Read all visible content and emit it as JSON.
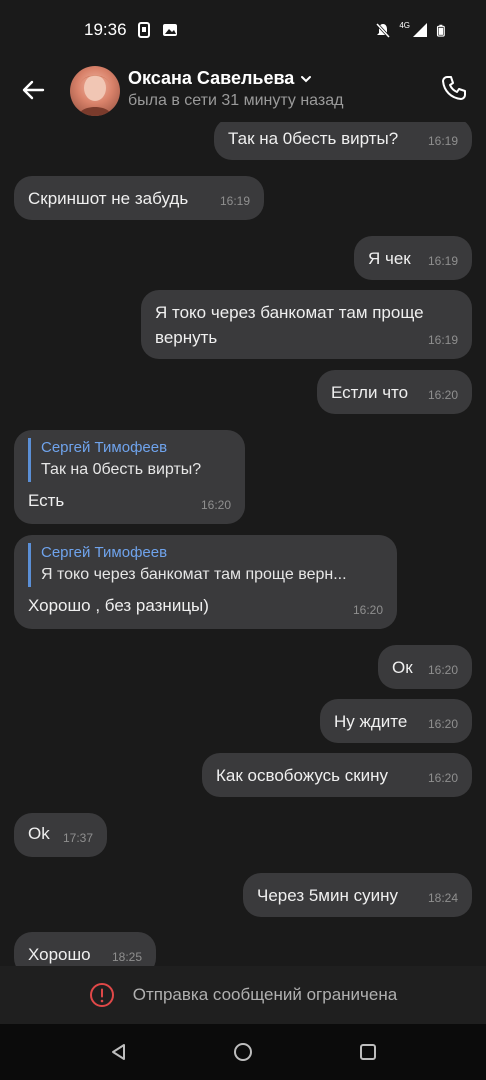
{
  "status_bar": {
    "time": "19:36",
    "left_icons": [
      "sim-icon",
      "image-icon"
    ],
    "right_icons": [
      "mute-icon",
      "4g-icon",
      "signal-icon",
      "battery-icon"
    ],
    "network_label": "4G"
  },
  "header": {
    "contact_name": "Оксана Савельева",
    "last_seen": "была в сети 31 минуту назад"
  },
  "messages": [
    {
      "side": "right",
      "text": "Так на 0бесть вирты?",
      "time": "16:19"
    },
    {
      "side": "left",
      "text": "Скриншот не забудь",
      "time": "16:19"
    },
    {
      "side": "right",
      "text": "Я чек",
      "time": "16:19"
    },
    {
      "side": "right",
      "text_line1": "Я токо через банкомат там проще",
      "text_line2": "вернуть",
      "time": "16:19"
    },
    {
      "side": "right",
      "text": "Естли что",
      "time": "16:20"
    },
    {
      "side": "left",
      "reply_author": "Сергей Тимофеев",
      "reply_text": "Так на 0бесть вирты?",
      "text": "Есть",
      "time": "16:20"
    },
    {
      "side": "left",
      "reply_author": "Сергей Тимофеев",
      "reply_text": "Я токо через банкомат там проще верн...",
      "text": "Хорошо , без разницы)",
      "time": "16:20"
    },
    {
      "side": "right",
      "text": "Ок",
      "time": "16:20"
    },
    {
      "side": "right",
      "text": "Ну ждите",
      "time": "16:20"
    },
    {
      "side": "right",
      "text": "Как освобожусь скину",
      "time": "16:20"
    },
    {
      "side": "left",
      "text": "Ok",
      "time": "17:37"
    },
    {
      "side": "right",
      "text": "Через 5мин суину",
      "time": "18:24"
    },
    {
      "side": "left",
      "text": "Хорошо",
      "time": "18:25"
    }
  ],
  "restriction": {
    "text": "Отправка сообщений ограничена"
  },
  "colors": {
    "background": "#1a1a1a",
    "bubble": "#3a3a3c",
    "reply_accent": "#6fa3ec",
    "warning": "#e04848"
  }
}
